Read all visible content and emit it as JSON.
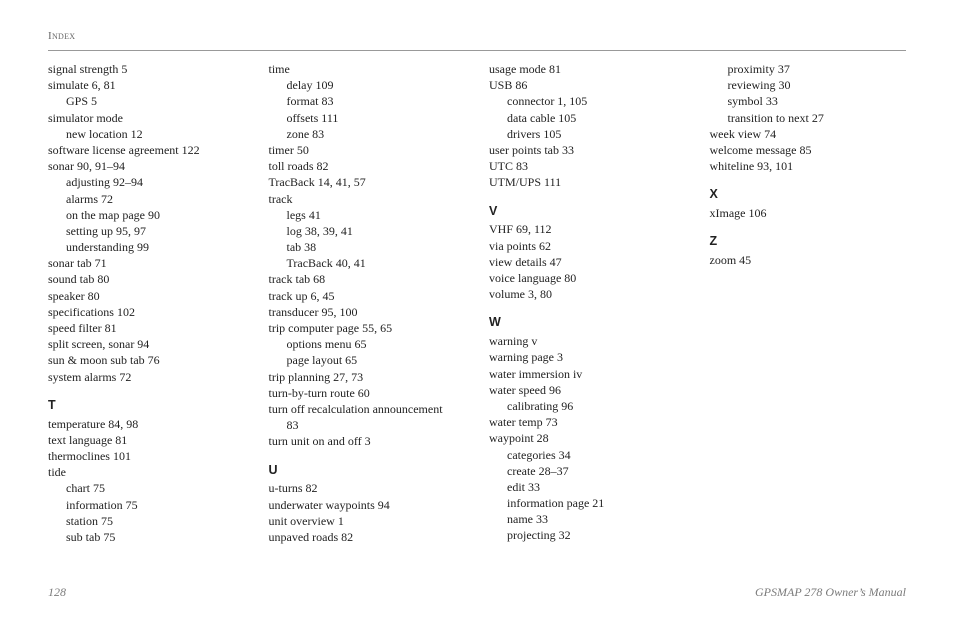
{
  "header": {
    "section": "Index"
  },
  "footer": {
    "page_number": "128",
    "manual": "GPSMAP 278 Owner’s Manual"
  },
  "columns": [
    {
      "blocks": [
        {
          "type": "entries",
          "items": [
            {
              "t": "signal strength  5",
              "lvl": 0
            },
            {
              "t": "simulate  6, 81",
              "lvl": 0
            },
            {
              "t": "GPS  5",
              "lvl": 1
            },
            {
              "t": "simulator mode",
              "lvl": 0
            },
            {
              "t": "new location  12",
              "lvl": 1
            },
            {
              "t": "software license agreement  122",
              "lvl": 0
            },
            {
              "t": "sonar  90, 91–94",
              "lvl": 0
            },
            {
              "t": "adjusting  92–94",
              "lvl": 1
            },
            {
              "t": "alarms  72",
              "lvl": 1
            },
            {
              "t": "on the map page  90",
              "lvl": 1
            },
            {
              "t": "setting up  95, 97",
              "lvl": 1
            },
            {
              "t": "understanding  99",
              "lvl": 1
            },
            {
              "t": "sonar tab  71",
              "lvl": 0
            },
            {
              "t": "sound tab  80",
              "lvl": 0
            },
            {
              "t": "speaker  80",
              "lvl": 0
            },
            {
              "t": "specifications  102",
              "lvl": 0
            },
            {
              "t": "speed filter  81",
              "lvl": 0
            },
            {
              "t": "split screen, sonar  94",
              "lvl": 0
            },
            {
              "t": "sun & moon sub tab  76",
              "lvl": 0
            },
            {
              "t": "system alarms  72",
              "lvl": 0
            }
          ]
        },
        {
          "type": "letter",
          "text": "T"
        },
        {
          "type": "entries",
          "items": [
            {
              "t": "temperature  84, 98",
              "lvl": 0
            },
            {
              "t": "text language  81",
              "lvl": 0
            },
            {
              "t": "thermoclines  101",
              "lvl": 0
            },
            {
              "t": "tide",
              "lvl": 0
            },
            {
              "t": "chart  75",
              "lvl": 1
            },
            {
              "t": "information  75",
              "lvl": 1
            },
            {
              "t": "station  75",
              "lvl": 1
            },
            {
              "t": "sub tab  75",
              "lvl": 1
            }
          ]
        }
      ]
    },
    {
      "blocks": [
        {
          "type": "entries",
          "items": [
            {
              "t": "time",
              "lvl": 0
            },
            {
              "t": "delay  109",
              "lvl": 1
            },
            {
              "t": "format  83",
              "lvl": 1
            },
            {
              "t": "offsets  111",
              "lvl": 1
            },
            {
              "t": "zone  83",
              "lvl": 1
            },
            {
              "t": "timer  50",
              "lvl": 0
            },
            {
              "t": "toll roads  82",
              "lvl": 0
            },
            {
              "t": "TracBack  14, 41, 57",
              "lvl": 0
            },
            {
              "t": "track",
              "lvl": 0
            },
            {
              "t": "legs  41",
              "lvl": 1
            },
            {
              "t": "log  38, 39, 41",
              "lvl": 1
            },
            {
              "t": "tab  38",
              "lvl": 1
            },
            {
              "t": "TracBack  40, 41",
              "lvl": 1
            },
            {
              "t": "track tab  68",
              "lvl": 0
            },
            {
              "t": "track up  6, 45",
              "lvl": 0
            },
            {
              "t": "transducer  95, 100",
              "lvl": 0
            },
            {
              "t": "trip computer page  55, 65",
              "lvl": 0
            },
            {
              "t": "options menu  65",
              "lvl": 1
            },
            {
              "t": "page layout  65",
              "lvl": 1
            },
            {
              "t": "trip planning  27, 73",
              "lvl": 0
            },
            {
              "t": "turn-by-turn route  60",
              "lvl": 0
            },
            {
              "t": "turn off recalculation announcement",
              "lvl": 0
            },
            {
              "t": "83",
              "lvl": 1
            },
            {
              "t": "turn unit on and off  3",
              "lvl": 0
            }
          ]
        },
        {
          "type": "letter",
          "text": "U"
        },
        {
          "type": "entries",
          "items": [
            {
              "t": "u-turns  82",
              "lvl": 0
            },
            {
              "t": "underwater waypoints  94",
              "lvl": 0
            },
            {
              "t": "unit overview  1",
              "lvl": 0
            },
            {
              "t": "unpaved roads  82",
              "lvl": 0
            }
          ]
        }
      ]
    },
    {
      "blocks": [
        {
          "type": "entries",
          "items": [
            {
              "t": "usage mode  81",
              "lvl": 0
            },
            {
              "t": "USB  86",
              "lvl": 0
            },
            {
              "t": "connector  1, 105",
              "lvl": 1
            },
            {
              "t": "data cable  105",
              "lvl": 1
            },
            {
              "t": "drivers  105",
              "lvl": 1
            },
            {
              "t": "user points tab  33",
              "lvl": 0
            },
            {
              "t": "UTC  83",
              "lvl": 0
            },
            {
              "t": "UTM/UPS  111",
              "lvl": 0
            }
          ]
        },
        {
          "type": "letter",
          "text": "V"
        },
        {
          "type": "entries",
          "items": [
            {
              "t": "VHF  69, 112",
              "lvl": 0
            },
            {
              "t": "via points  62",
              "lvl": 0
            },
            {
              "t": "view details  47",
              "lvl": 0
            },
            {
              "t": "voice language  80",
              "lvl": 0
            },
            {
              "t": "volume  3, 80",
              "lvl": 0
            }
          ]
        },
        {
          "type": "letter",
          "text": "W"
        },
        {
          "type": "entries",
          "items": [
            {
              "t": "warning  v",
              "lvl": 0
            },
            {
              "t": "warning page  3",
              "lvl": 0
            },
            {
              "t": "water immersion  iv",
              "lvl": 0
            },
            {
              "t": "water speed  96",
              "lvl": 0
            },
            {
              "t": "calibrating  96",
              "lvl": 1
            },
            {
              "t": "water temp  73",
              "lvl": 0
            },
            {
              "t": "waypoint  28",
              "lvl": 0
            },
            {
              "t": "categories  34",
              "lvl": 1
            },
            {
              "t": "create  28–37",
              "lvl": 1
            },
            {
              "t": "edit  33",
              "lvl": 1
            },
            {
              "t": "information page  21",
              "lvl": 1
            },
            {
              "t": "name  33",
              "lvl": 1
            },
            {
              "t": "projecting  32",
              "lvl": 1
            }
          ]
        }
      ]
    },
    {
      "blocks": [
        {
          "type": "entries",
          "items": [
            {
              "t": "proximity  37",
              "lvl": 1
            },
            {
              "t": "reviewing  30",
              "lvl": 1
            },
            {
              "t": "symbol  33",
              "lvl": 1
            },
            {
              "t": "transition to next  27",
              "lvl": 1
            },
            {
              "t": "week view  74",
              "lvl": 0
            },
            {
              "t": "welcome message  85",
              "lvl": 0
            },
            {
              "t": "whiteline  93, 101",
              "lvl": 0
            }
          ]
        },
        {
          "type": "letter",
          "text": "X"
        },
        {
          "type": "entries",
          "items": [
            {
              "t": "xImage  106",
              "lvl": 0
            }
          ]
        },
        {
          "type": "letter",
          "text": "Z"
        },
        {
          "type": "entries",
          "items": [
            {
              "t": "zoom  45",
              "lvl": 0
            }
          ]
        }
      ]
    }
  ]
}
